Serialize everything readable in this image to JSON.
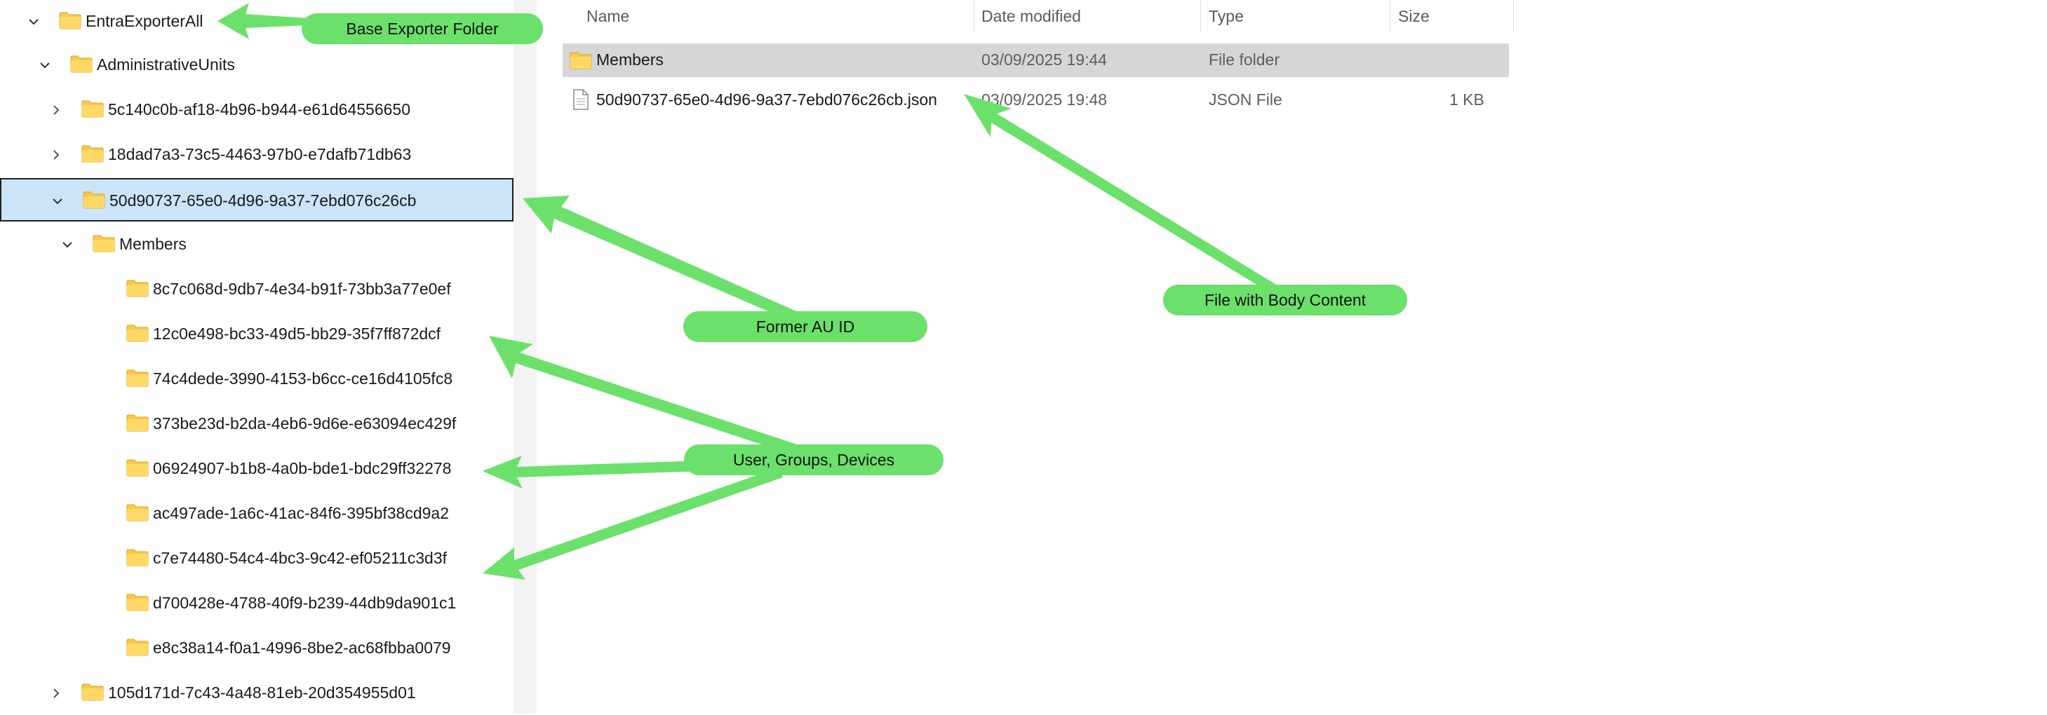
{
  "nav": {
    "items": [
      {
        "label": "EntraExporterAll",
        "chevron": "down"
      },
      {
        "label": "AdministrativeUnits",
        "chevron": "down"
      },
      {
        "label": "5c140c0b-af18-4b96-b944-e61d64556650",
        "chevron": "right"
      },
      {
        "label": "18dad7a3-73c5-4463-97b0-e7dafb71db63",
        "chevron": "right"
      },
      {
        "label": "50d90737-65e0-4d96-9a37-7ebd076c26cb",
        "chevron": "down",
        "selected": true
      },
      {
        "label": "Members",
        "chevron": "down"
      },
      {
        "label": "8c7c068d-9db7-4e34-b91f-73bb3a77e0ef",
        "chevron": "none"
      },
      {
        "label": "12c0e498-bc33-49d5-bb29-35f7ff872dcf",
        "chevron": "none"
      },
      {
        "label": "74c4dede-3990-4153-b6cc-ce16d4105fc8",
        "chevron": "none"
      },
      {
        "label": "373be23d-b2da-4eb6-9d6e-e63094ec429f",
        "chevron": "none"
      },
      {
        "label": "06924907-b1b8-4a0b-bde1-bdc29ff32278",
        "chevron": "none"
      },
      {
        "label": "ac497ade-1a6c-41ac-84f6-395bf38cd9a2",
        "chevron": "none"
      },
      {
        "label": "c7e74480-54c4-4bc3-9c42-ef05211c3d3f",
        "chevron": "none"
      },
      {
        "label": "d700428e-4788-40f9-b239-44db9da901c1",
        "chevron": "none"
      },
      {
        "label": "e8c38a14-f0a1-4996-8be2-ac68fbba0079",
        "chevron": "none"
      },
      {
        "label": "105d171d-7c43-4a48-81eb-20d354955d01",
        "chevron": "right"
      }
    ]
  },
  "file_list": {
    "columns": {
      "name": "Name",
      "date": "Date modified",
      "type": "Type",
      "size": "Size"
    },
    "rows": [
      {
        "name": "Members",
        "date": "03/09/2025 19:44",
        "type": "File folder",
        "size": "",
        "icon": "folder-icon",
        "highlighted": true
      },
      {
        "name": "50d90737-65e0-4d96-9a37-7ebd076c26cb.json",
        "date": "03/09/2025 19:48",
        "type": "JSON File",
        "size": "1 KB",
        "icon": "file-icon",
        "highlighted": false
      }
    ]
  },
  "annotations": {
    "base_exporter_folder": "Base Exporter Folder",
    "former_au_id": "Former AU ID",
    "file_with_body_content": "File with Body Content",
    "user_groups_devices": "User, Groups, Devices"
  },
  "colors": {
    "annotation_green": "#6be16b",
    "selection_bg": "#cce4f7",
    "folder_yellow": "#f7c948",
    "row_highlight": "#d6d6d6"
  }
}
